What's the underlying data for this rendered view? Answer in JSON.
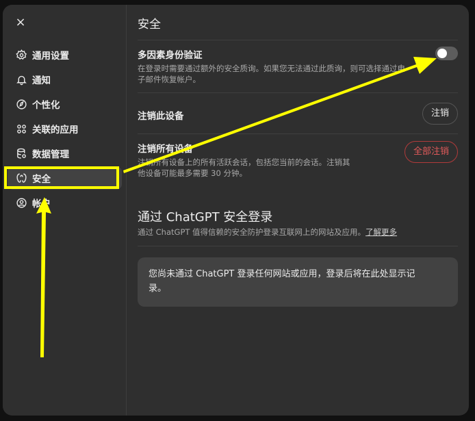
{
  "sidebar": {
    "close_icon": "×",
    "items": [
      {
        "label": "通用设置",
        "icon": "gear-icon",
        "active": false
      },
      {
        "label": "通知",
        "icon": "bell-icon",
        "active": false
      },
      {
        "label": "个性化",
        "icon": "personalization-icon",
        "active": false
      },
      {
        "label": "关联的应用",
        "icon": "apps-grid-icon",
        "active": false
      },
      {
        "label": "数据管理",
        "icon": "database-icon",
        "active": false
      },
      {
        "label": "安全",
        "icon": "shield-icon",
        "active": true
      },
      {
        "label": "帐户",
        "icon": "user-circle-icon",
        "active": false
      }
    ]
  },
  "main": {
    "title": "安全",
    "mfa": {
      "title": "多因素身份验证",
      "desc_line1": "在登录时需要通过额外的安全质询。如果您无法通过此质询，则可选择通过电",
      "desc_line2": "子邮件恢复帐户。",
      "enabled": false
    },
    "logout_device": {
      "title": "注销此设备",
      "button": "注销"
    },
    "logout_all": {
      "title": "注销所有设备",
      "desc_line1": "注销所有设备上的所有活跃会话，包括您当前的会话。注销其",
      "desc_line2": "他设备可能最多需要 30 分钟。",
      "button": "全部注销"
    },
    "sso": {
      "title": "通过 ChatGPT 安全登录",
      "desc": "通过 ChatGPT 值得信赖的安全防护登录互联网上的网站及应用。",
      "learn_more": "了解更多",
      "notice_line1": "您尚未通过 ChatGPT 登录任何网站或应用，登录后将在此处显示记",
      "notice_line2": "录。"
    }
  },
  "colors": {
    "annotation": "#ffff00",
    "danger": "#e05a5a",
    "panel": "#2f2f2f",
    "active_item": "#424242"
  }
}
